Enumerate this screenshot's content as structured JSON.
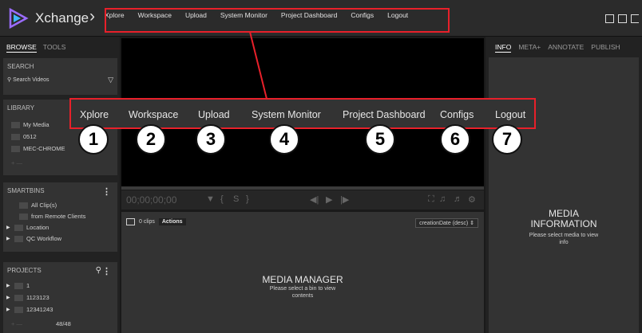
{
  "app": {
    "title": "Xchange",
    "logo_icon": "xchange-logo-icon",
    "breadcrumb_icon": "chevron-right-icon"
  },
  "topnav": {
    "items": [
      "Xplore",
      "Workspace",
      "Upload",
      "System Monitor",
      "Project Dashboard",
      "Configs",
      "Logout"
    ],
    "highlight_color": "#e8202a"
  },
  "left": {
    "tabs": {
      "browse": "BROWSE",
      "tools": "TOOLS"
    },
    "search": {
      "title": "SEARCH",
      "placeholder": "Search Videos"
    },
    "library": {
      "title": "LIBRARY",
      "items": [
        "My Media",
        "0512",
        "MEC-CHROME"
      ]
    },
    "smartbins": {
      "title": "SMARTBINS",
      "items": [
        "All Clip(s)",
        "from Remote Clients",
        "Location",
        "QC Workflow"
      ]
    },
    "projects": {
      "title": "PROJECTS",
      "items": [
        "1",
        "1123123",
        "12341243"
      ],
      "count": "48/48"
    }
  },
  "center": {
    "timecode": "00;00;00;00",
    "clips_count": "0 clips",
    "actions_label": "Actions",
    "sort_value": "creationDate (desc)",
    "media_manager_title": "MEDIA MANAGER",
    "media_manager_sub1": "Please select a bin to view",
    "media_manager_sub2": "contents"
  },
  "right": {
    "tabs": [
      "INFO",
      "META+",
      "ANNOTATE",
      "PUBLISH"
    ],
    "info_title1": "MEDIA",
    "info_title2": "INFORMATION",
    "info_sub1": "Please select media to view",
    "info_sub2": "info"
  },
  "callout": {
    "items": [
      "Xplore",
      "Workspace",
      "Upload",
      "System Monitor",
      "Project Dashboard",
      "Configs",
      "Logout"
    ],
    "badges": [
      "1",
      "2",
      "3",
      "4",
      "5",
      "6",
      "7"
    ]
  }
}
